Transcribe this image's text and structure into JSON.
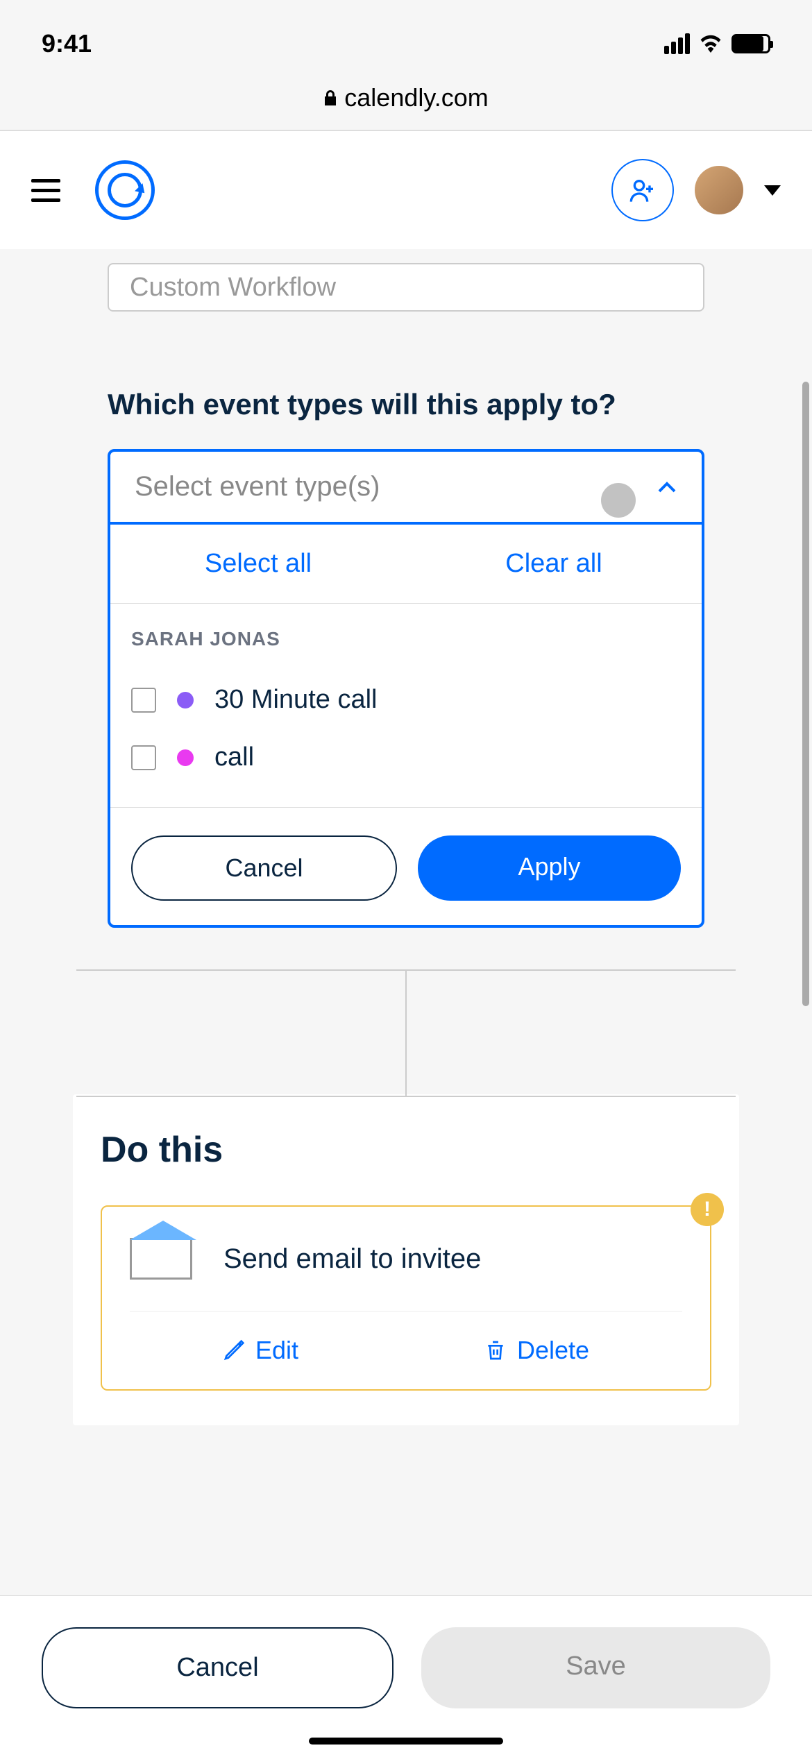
{
  "statusBar": {
    "time": "9:41"
  },
  "url": "calendly.com",
  "workflowBoxPartial": "Custom Workflow",
  "sectionTitle": "Which event types will this apply to?",
  "dropdown": {
    "placeholder": "Select event type(s)",
    "selectAll": "Select all",
    "clearAll": "Clear all",
    "groupName": "SARAH JONAS",
    "options": [
      {
        "label": "30 Minute call",
        "color": "#8b5cf6"
      },
      {
        "label": "call",
        "color": "#e93af0"
      }
    ],
    "cancel": "Cancel",
    "apply": "Apply"
  },
  "doThis": {
    "title": "Do this",
    "actionLabel": "Send email to invitee",
    "edit": "Edit",
    "delete": "Delete"
  },
  "bottomBar": {
    "cancel": "Cancel",
    "save": "Save"
  }
}
